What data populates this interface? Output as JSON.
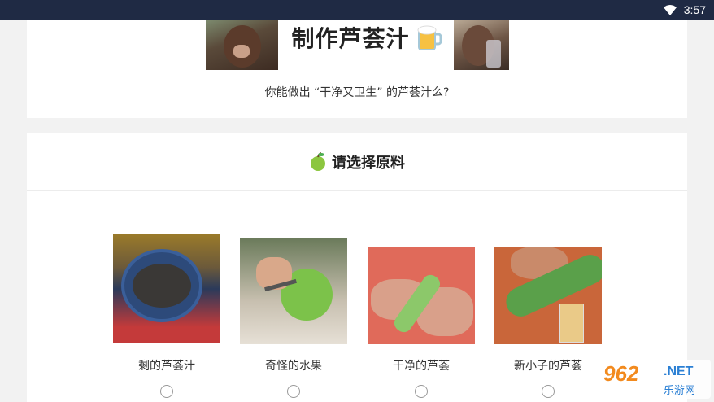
{
  "status_bar": {
    "time": "3:57",
    "wifi_icon": "wifi-icon"
  },
  "header": {
    "title": "制作芦荟汁",
    "title_emoji": "🍺",
    "subtitle": "你能做出 “干净又卫生” 的芦荟汁么?"
  },
  "ingredients": {
    "section_title": "请选择原料",
    "section_icon": "green-apple-icon",
    "options": [
      {
        "label": "剩的芦荟汁"
      },
      {
        "label": "奇怪的水果"
      },
      {
        "label": "干净的芦荟"
      },
      {
        "label": "新小子的芦荟"
      }
    ]
  },
  "watermark": {
    "number": "962",
    "domain": ".NET",
    "name": "乐游网"
  }
}
